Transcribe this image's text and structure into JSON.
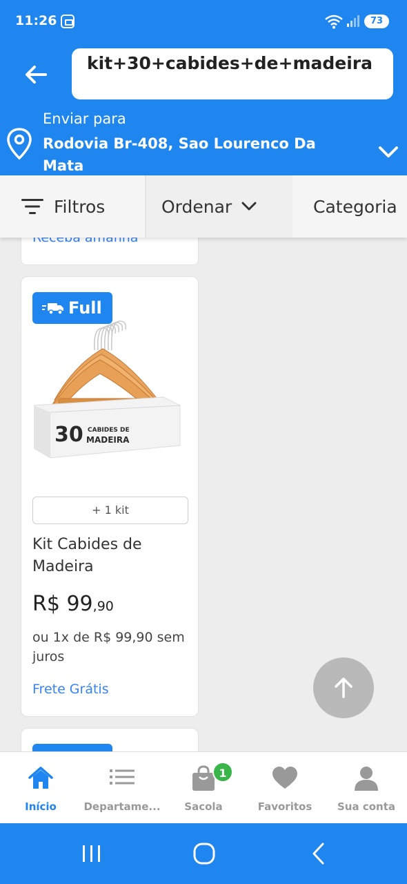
{
  "status_bar": {
    "time": "11:26",
    "battery": "73",
    "icons": [
      "screenshot-icon",
      "wifi-icon",
      "signal-icon",
      "battery-icon"
    ]
  },
  "header": {
    "search_query": "kit+30+cabides+de+madeira",
    "ship_to_label": "Enviar para",
    "ship_to_address": "Rodovia Br-408, Sao Lourenco Da Mata"
  },
  "filters": {
    "filters_label": "Filtros",
    "order_label": "Ordenar",
    "category_label": "Categoria"
  },
  "previous_card": {
    "text": "Receba amanhã"
  },
  "product": {
    "badge": "Full",
    "image_text_big": "30",
    "image_text_small_1": "CABIDES DE",
    "image_text_small_2": "MADEIRA",
    "variant_chip": "+ 1 kit",
    "title": "Kit Cabides de Madeira",
    "price_main": "R$ 99",
    "price_cents": ",90",
    "installments": "ou 1x de R$ 99,90 sem juros",
    "shipping": "Frete Grátis"
  },
  "bottom_nav": {
    "items": [
      {
        "label": "Início",
        "icon": "home-icon",
        "active": true
      },
      {
        "label": "Departame...",
        "icon": "list-icon",
        "active": false
      },
      {
        "label": "Sacola",
        "icon": "bag-icon",
        "active": false
      },
      {
        "label": "Favoritos",
        "icon": "heart-icon",
        "active": false
      },
      {
        "label": "Sua conta",
        "icon": "user-icon",
        "active": false
      }
    ],
    "cart_count": "1"
  },
  "colors": {
    "brand_blue": "#1f86f0",
    "link_blue": "#3483fa",
    "badge_green": "#39b54a"
  }
}
